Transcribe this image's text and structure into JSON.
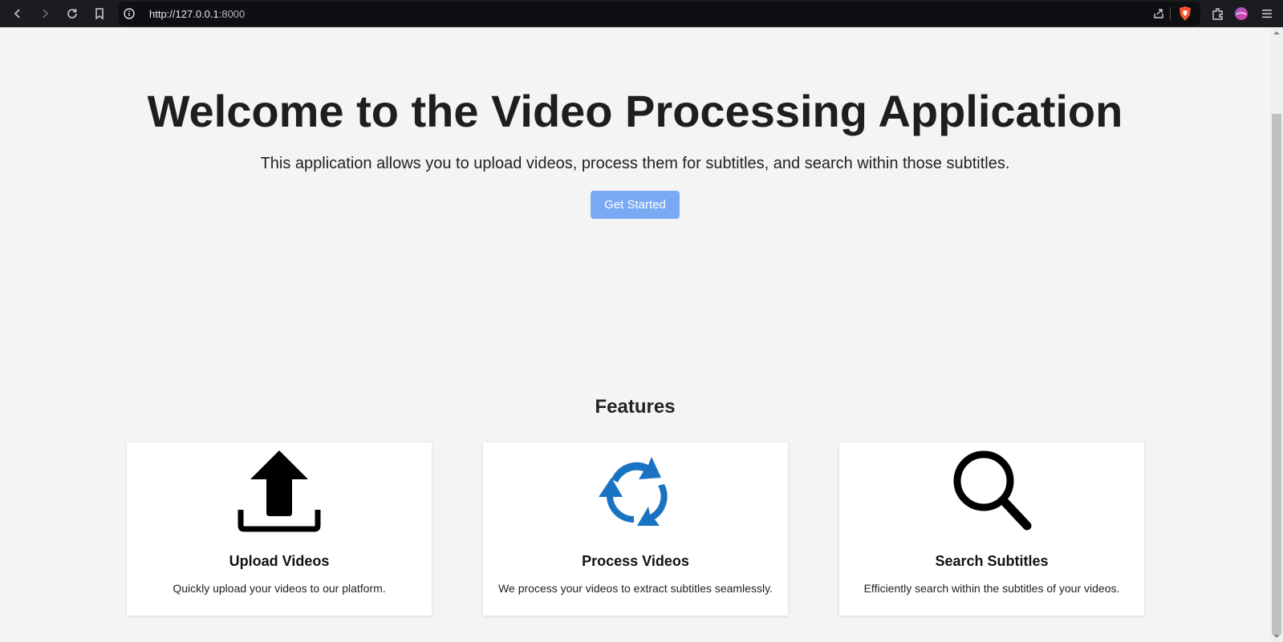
{
  "browser": {
    "url_host": "http://127.0.0.1",
    "url_port": ":8000"
  },
  "hero": {
    "title": "Welcome to the Video Processing Application",
    "subtitle": "This application allows you to upload videos, process them for subtitles, and search within those subtitles.",
    "cta_label": "Get Started"
  },
  "features": {
    "heading": "Features",
    "items": [
      {
        "icon": "upload-icon",
        "title": "Upload Videos",
        "description": "Quickly upload your videos to our platform."
      },
      {
        "icon": "refresh-cycle-icon",
        "title": "Process Videos",
        "description": "We process your videos to extract subtitles seamlessly."
      },
      {
        "icon": "magnifier-icon",
        "title": "Search Subtitles",
        "description": "Efficiently search within the subtitles of your videos."
      }
    ]
  },
  "colors": {
    "cta_background": "#7aa9f3",
    "process_icon": "#1a72c2",
    "page_background": "#f4f4f4"
  }
}
